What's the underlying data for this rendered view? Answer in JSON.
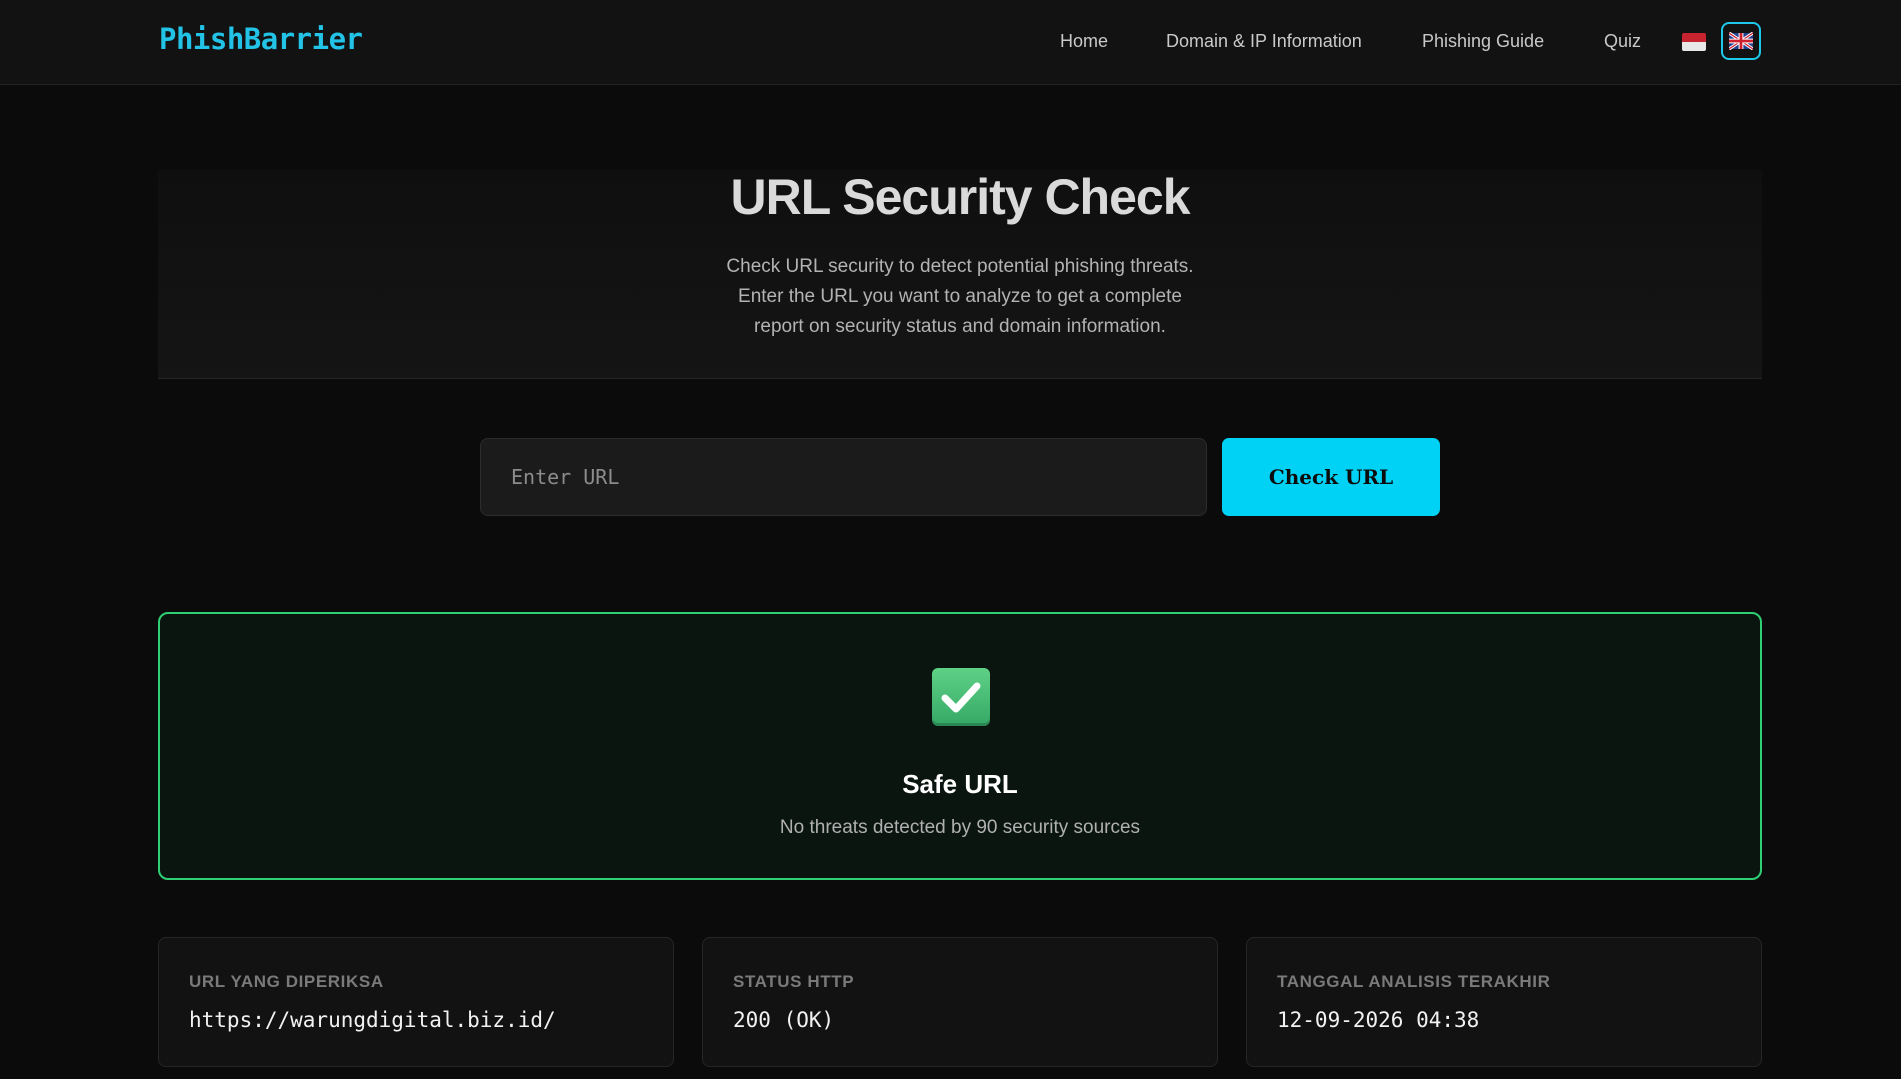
{
  "navbar": {
    "brand": "PhishBarrier",
    "links": [
      {
        "label": "Home"
      },
      {
        "label": "Domain & IP Information"
      },
      {
        "label": "Phishing Guide"
      },
      {
        "label": "Quiz"
      }
    ],
    "languages": [
      {
        "code": "id",
        "icon": "indonesia-flag-icon",
        "active": false
      },
      {
        "code": "en",
        "icon": "uk-flag-icon",
        "active": true
      }
    ]
  },
  "hero": {
    "title": "URL Security Check",
    "subtitle": "Check URL security to detect potential phishing threats. Enter the URL you want to analyze to get a complete report on security status and domain information."
  },
  "search": {
    "placeholder": "Enter URL",
    "value": "",
    "button_label": "Check URL"
  },
  "result": {
    "icon": "check-mark-icon",
    "title": "Safe URL",
    "description": "No threats detected by 90 security sources",
    "status_color": "#2fcf74"
  },
  "info_cards": [
    {
      "label": "URL YANG DIPERIKSA",
      "value": "https://warungdigital.biz.id/"
    },
    {
      "label": "STATUS HTTP",
      "value": "200 (OK)"
    },
    {
      "label": "TANGGAL ANALISIS TERAKHIR",
      "value": "12-09-2026 04:38"
    }
  ],
  "colors": {
    "accent": "#00d2f5",
    "brand": "#22c3e6",
    "background": "#0b0b0b"
  }
}
